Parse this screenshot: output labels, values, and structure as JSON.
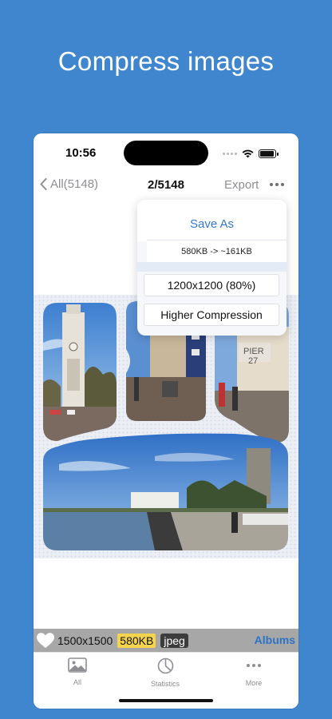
{
  "headline": "Compress images",
  "status_bar": {
    "time": "10:56"
  },
  "nav": {
    "back_label": "All(5148)",
    "title": "2/5148",
    "export_label": "Export"
  },
  "export_menu": {
    "save_as": "Save As",
    "size_change": "580KB -> ~161KB",
    "option_resolution": "1200x1200 (80%)",
    "option_higher": "Higher Compression"
  },
  "info_bar": {
    "dimensions": "1500x1500",
    "file_size": "580KB",
    "format": "jpeg",
    "albums_label": "Albums"
  },
  "tab_bar": {
    "items": [
      {
        "label": "All",
        "icon": "photo-icon"
      },
      {
        "label": "Statistics",
        "icon": "pie-chart-icon"
      },
      {
        "label": "More",
        "icon": "more-dots-icon"
      }
    ]
  },
  "colors": {
    "background": "#3f86cf",
    "accent": "#3478d8",
    "size_badge": "#f3d44c",
    "format_badge": "#3c3c3c",
    "albums": "#2d72c6"
  }
}
